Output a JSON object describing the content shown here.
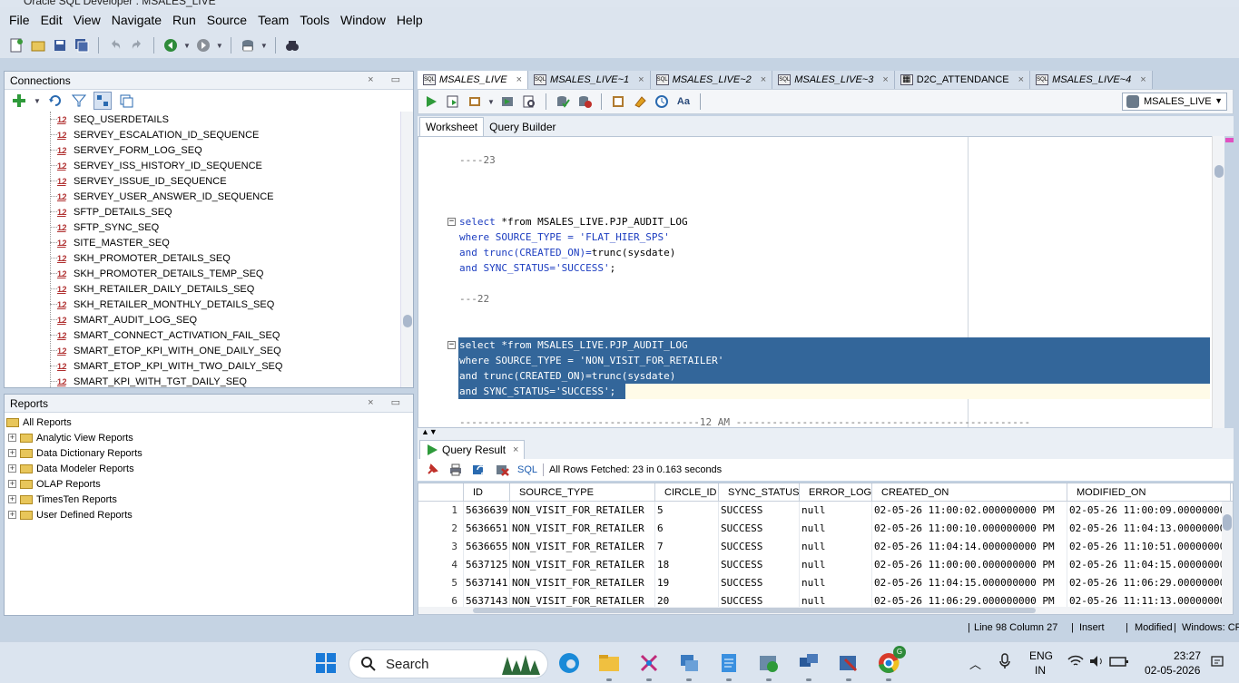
{
  "window": {
    "title": "Oracle SQL Developer : MSALES_LIVE"
  },
  "menu": [
    "File",
    "Edit",
    "View",
    "Navigate",
    "Run",
    "Source",
    "Team",
    "Tools",
    "Window",
    "Help"
  ],
  "connections_panel": {
    "title": "Connections",
    "controls": "× ▭",
    "sequences": [
      "SEQ_USERDETAILS",
      "SERVEY_ESCALATION_ID_SEQUENCE",
      "SERVEY_FORM_LOG_SEQ",
      "SERVEY_ISS_HISTORY_ID_SEQUENCE",
      "SERVEY_ISSUE_ID_SEQUENCE",
      "SERVEY_USER_ANSWER_ID_SEQUENCE",
      "SFTP_DETAILS_SEQ",
      "SFTP_SYNC_SEQ",
      "SITE_MASTER_SEQ",
      "SKH_PROMOTER_DETAILS_SEQ",
      "SKH_PROMOTER_DETAILS_TEMP_SEQ",
      "SKH_RETAILER_DAILY_DETAILS_SEQ",
      "SKH_RETAILER_MONTHLY_DETAILS_SEQ",
      "SMART_AUDIT_LOG_SEQ",
      "SMART_CONNECT_ACTIVATION_FAIL_SEQ",
      "SMART_ETOP_KPI_WITH_ONE_DAILY_SEQ",
      "SMART_ETOP_KPI_WITH_TWO_DAILY_SEQ",
      "SMART_KPI_WITH_TGT_DAILY_SEQ"
    ],
    "seq_icon_text": "1.2"
  },
  "reports_panel": {
    "title": "Reports",
    "controls": "× ▭",
    "root": "All Reports",
    "items": [
      "Analytic View Reports",
      "Data Dictionary Reports",
      "Data Modeler Reports",
      "OLAP Reports",
      "TimesTen Reports",
      "User Defined Reports"
    ]
  },
  "editor_tabs": [
    "MSALES_LIVE",
    "MSALES_LIVE~1",
    "MSALES_LIVE~2",
    "MSALES_LIVE~3",
    "D2C_ATTENDANCE",
    "MSALES_LIVE~4"
  ],
  "connection_select": "MSALES_LIVE",
  "worksheet_tabs": [
    "Worksheet",
    "Query Builder"
  ],
  "code": {
    "c23": "----23",
    "q1_l1": "select *from MSALES_LIVE.PJP_AUDIT_LOG",
    "q1_l2a": "where SOURCE_TYPE = ",
    "q1_l2b": "'FLAT_HIER_SPS'",
    "q1_l3a": "and trunc(CREATED_ON)=",
    "q1_l3b": "trunc(sysdate)",
    "q1_l4a": "and SYNC_STATUS=",
    "q1_l4b": "'SUCCESS'",
    "q1_l4c": ";",
    "c22": "---22",
    "q2_l1": "select *from MSALES_LIVE.PJP_AUDIT_LOG",
    "q2_l2": "where SOURCE_TYPE = 'NON_VISIT_FOR_RETAILER'",
    "q2_l3": "and trunc(CREATED_ON)=trunc(sysdate)",
    "q2_l4": "and SYNC_STATUS='SUCCESS';",
    "c12": "----------------------------------------12 AM -------------------------------------------------"
  },
  "query_result": {
    "tab": "Query Result",
    "sql_label": "SQL",
    "fetch_status": "All Rows Fetched: 23 in 0.163 seconds",
    "columns": [
      "ID",
      "SOURCE_TYPE",
      "CIRCLE_ID",
      "SYNC_STATUS",
      "ERROR_LOG",
      "CREATED_ON",
      "MODIFIED_ON"
    ],
    "rows": [
      [
        "1",
        "5636639",
        "NON_VISIT_FOR_RETAILER",
        "5",
        "SUCCESS",
        "null",
        "02-05-26 11:00:02.000000000 PM",
        "02-05-26 11:00:09.000000000"
      ],
      [
        "2",
        "5636651",
        "NON_VISIT_FOR_RETAILER",
        "6",
        "SUCCESS",
        "null",
        "02-05-26 11:00:10.000000000 PM",
        "02-05-26 11:04:13.000000000"
      ],
      [
        "3",
        "5636655",
        "NON_VISIT_FOR_RETAILER",
        "7",
        "SUCCESS",
        "null",
        "02-05-26 11:04:14.000000000 PM",
        "02-05-26 11:10:51.000000000"
      ],
      [
        "4",
        "5637125",
        "NON_VISIT_FOR_RETAILER",
        "18",
        "SUCCESS",
        "null",
        "02-05-26 11:00:00.000000000 PM",
        "02-05-26 11:04:15.000000000"
      ],
      [
        "5",
        "5637141",
        "NON_VISIT_FOR_RETAILER",
        "19",
        "SUCCESS",
        "null",
        "02-05-26 11:04:15.000000000 PM",
        "02-05-26 11:06:29.000000000"
      ],
      [
        "6",
        "5637143",
        "NON_VISIT_FOR_RETAILER",
        "20",
        "SUCCESS",
        "null",
        "02-05-26 11:06:29.000000000 PM",
        "02-05-26 11:11:13.000000000"
      ]
    ]
  },
  "status": {
    "position": "Line 98 Column 27",
    "mode": "Insert",
    "modified": "Modified",
    "platform": "Windows: CF"
  },
  "taskbar": {
    "search": "Search",
    "lang1": "ENG",
    "lang2": "IN",
    "time": "23:27",
    "date": "02-05-2026",
    "badge": "G"
  }
}
